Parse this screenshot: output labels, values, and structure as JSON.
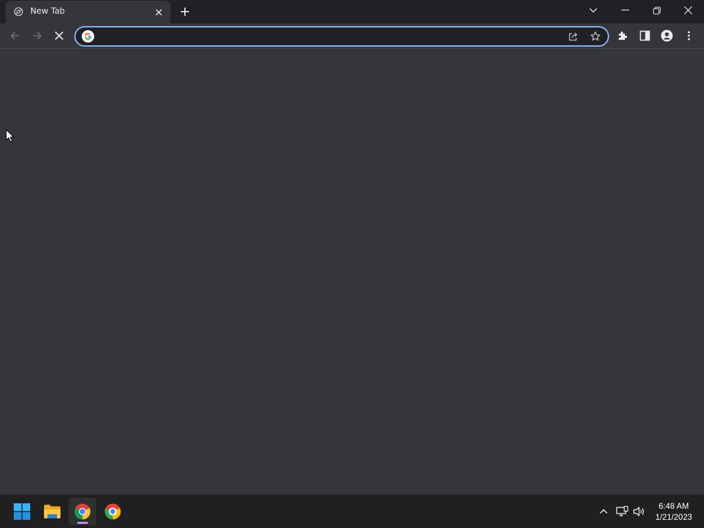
{
  "browser": {
    "tab": {
      "title": "New Tab",
      "favicon": "chrome-new-tab-icon"
    },
    "window_controls": {
      "tab_search": "chevron-down-icon",
      "minimize": "minimize-icon",
      "restore": "restore-icon",
      "close": "close-icon"
    },
    "toolbar": {
      "back": "arrow-left-icon",
      "forward": "arrow-right-icon",
      "stop": "stop-loading-icon",
      "omnibox": {
        "value": "",
        "placeholder": "",
        "search_engine_icon": "google-g-icon",
        "share": "share-icon",
        "bookmark": "star-icon"
      },
      "extensions": "puzzle-icon",
      "side_panel": "side-panel-icon",
      "profile": "profile-icon",
      "menu": "more-vert-icon"
    }
  },
  "taskbar": {
    "apps": [
      {
        "name": "Start",
        "icon": "windows-start-icon"
      },
      {
        "name": "File Explorer",
        "icon": "folder-icon"
      },
      {
        "name": "Google Chrome",
        "icon": "chrome-icon",
        "active": true
      },
      {
        "name": "Chrome Beta",
        "icon": "chrome-alt-icon"
      }
    ],
    "tray": {
      "overflow": "chevron-up-icon",
      "network": "network-icon",
      "volume": "speaker-icon"
    },
    "clock": {
      "time": "6:48 AM",
      "date": "1/21/2023"
    }
  },
  "colors": {
    "titlebar": "#202124",
    "toolbar": "#35363a",
    "omnibox_border": "#8ab4f8",
    "taskbar": "#202020",
    "active_indicator": "#c58af9"
  }
}
